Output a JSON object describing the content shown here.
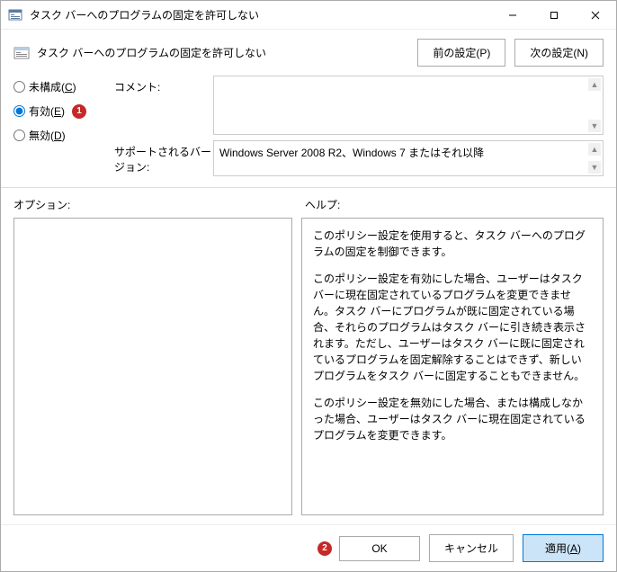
{
  "titlebar": {
    "title": "タスク バーへのプログラムの固定を許可しない"
  },
  "header": {
    "text": "タスク バーへのプログラムの固定を許可しない",
    "prev": "前の設定(P)",
    "next": "次の設定(N)"
  },
  "radios": {
    "not_configured": "未構成(C)",
    "enabled": "有効(E)",
    "disabled": "無効(D)",
    "badge1": "1"
  },
  "fields": {
    "comment_label": "コメント:",
    "version_label": "サポートされるバージョン:",
    "version_value": "Windows Server 2008 R2、Windows 7 またはそれ以降"
  },
  "labels": {
    "options": "オプション:",
    "help": "ヘルプ:"
  },
  "help": {
    "p1": "このポリシー設定を使用すると、タスク バーへのプログラムの固定を制御できます。",
    "p2": "このポリシー設定を有効にした場合、ユーザーはタスク バーに現在固定されているプログラムを変更できません。タスク バーにプログラムが既に固定されている場合、それらのプログラムはタスク バーに引き続き表示されます。ただし、ユーザーはタスク バーに既に固定されているプログラムを固定解除することはできず、新しいプログラムをタスク バーに固定することもできません。",
    "p3": "このポリシー設定を無効にした場合、または構成しなかった場合、ユーザーはタスク バーに現在固定されているプログラムを変更できます。"
  },
  "footer": {
    "badge2": "2",
    "ok": "OK",
    "cancel": "キャンセル",
    "apply": "適用(A)"
  }
}
